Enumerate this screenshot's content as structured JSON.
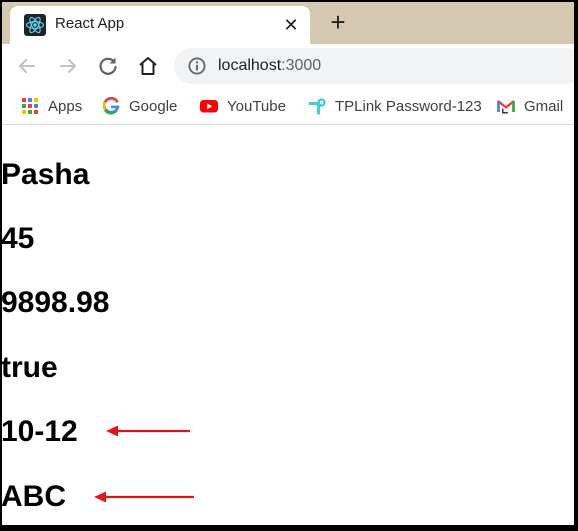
{
  "browser": {
    "tab_title": "React App",
    "tab_close_glyph": "✕",
    "new_tab_glyph": "+",
    "url_host": "localhost",
    "url_port": ":3000"
  },
  "bookmarks": [
    {
      "label": "Apps",
      "icon": "apps-grid-icon"
    },
    {
      "label": "Google",
      "icon": "google-icon"
    },
    {
      "label": "YouTube",
      "icon": "youtube-icon"
    },
    {
      "label": "TPLink Password-123",
      "icon": "tplink-icon"
    },
    {
      "label": "Gmail",
      "icon": "gmail-icon"
    }
  ],
  "content": {
    "headings": [
      "Pasha",
      "45",
      "9898.98",
      "true",
      "10-12",
      "ABC"
    ]
  },
  "annotations": {
    "arrow_color": "#e0161e"
  }
}
